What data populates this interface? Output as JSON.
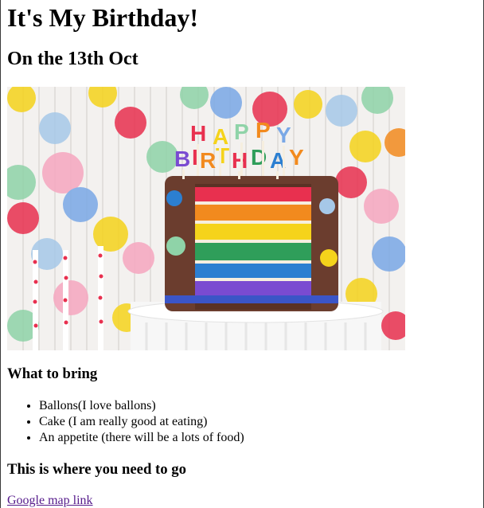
{
  "page": {
    "title": "It's My Birthday!",
    "date": "On the 13th Oct",
    "hero": {
      "candles": [
        "H",
        "A",
        "P",
        "P",
        "Y",
        "B",
        "I",
        "R",
        "T",
        "H",
        "D",
        "A",
        "Y"
      ],
      "colors": {
        "red": "#e8304f",
        "orange": "#f28a1e",
        "yellow": "#f5d31b",
        "green": "#2f9e5a",
        "blue": "#2c7fd1",
        "purple": "#7a4bd1",
        "frosting": "#6b3d2e"
      }
    },
    "bring_heading": "What to bring",
    "bring_items": [
      "Ballons(I love ballons)",
      "Cake (I am really good at eating)",
      "An appetite (there will be a lots of food)"
    ],
    "where_heading": "This is where you need to go",
    "map_link": "Google map link"
  }
}
